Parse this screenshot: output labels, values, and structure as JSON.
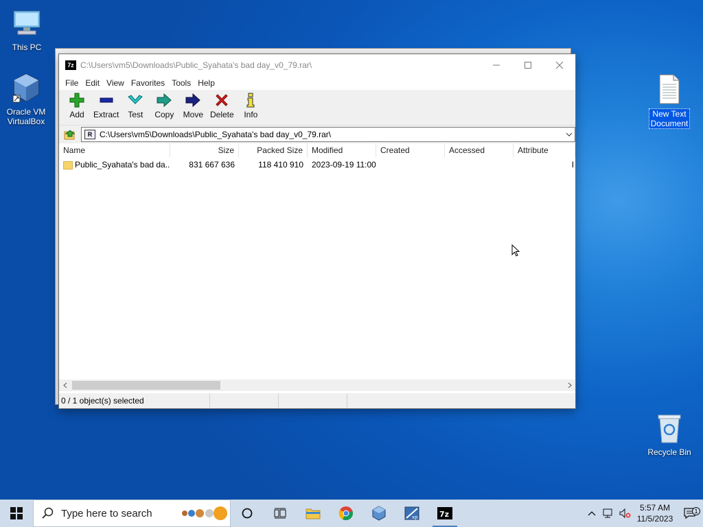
{
  "desktop": {
    "this_pc": "This PC",
    "virtualbox": "Oracle VM\nVirtualBox",
    "new_text_doc": "New Text\nDocument",
    "recycle_bin": "Recycle Bin"
  },
  "window": {
    "title": "C:\\Users\\vm5\\Downloads\\Public_Syahata's bad day_v0_79.rar\\",
    "app_icon_text": "7z"
  },
  "menu": [
    "File",
    "Edit",
    "View",
    "Favorites",
    "Tools",
    "Help"
  ],
  "toolbar": {
    "add": "Add",
    "extract": "Extract",
    "test": "Test",
    "copy": "Copy",
    "move": "Move",
    "delete": "Delete",
    "info": "Info"
  },
  "address": {
    "path": "C:\\Users\\vm5\\Downloads\\Public_Syahata's bad day_v0_79.rar\\",
    "badge": "R"
  },
  "columns": [
    "Name",
    "Size",
    "Packed Size",
    "Modified",
    "Created",
    "Accessed",
    "Attribute"
  ],
  "rows": [
    {
      "name": "Public_Syahata's bad da...",
      "size": "831 667 636",
      "packed": "118 410 910",
      "modified": "2023-09-19 11:00",
      "created": "",
      "accessed": "",
      "attr": "I"
    }
  ],
  "status": {
    "selected": "0 / 1 object(s) selected"
  },
  "taskbar": {
    "search_placeholder": "Type here to search",
    "time": "5:57 AM",
    "date": "11/5/2023",
    "notif_count": "1"
  },
  "colors": {
    "desktop_blue": "#0f66c8",
    "add_green": "#2aa52a",
    "delete_red": "#d42020",
    "move_navy": "#1a237e",
    "copy_teal": "#1e9c88",
    "test_cyan": "#28c8c8"
  }
}
